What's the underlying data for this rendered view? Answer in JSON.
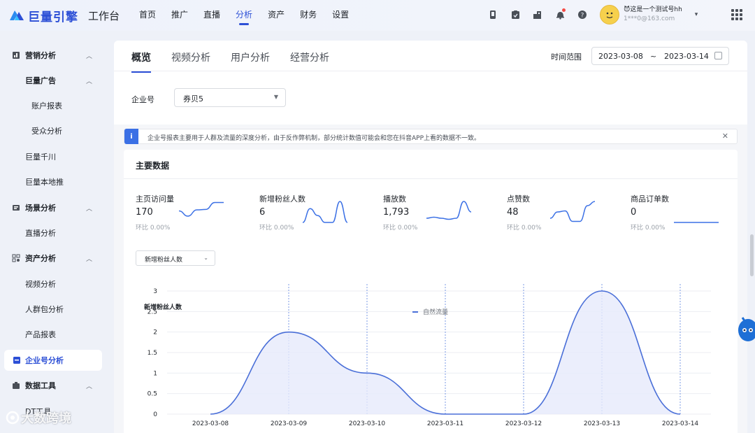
{
  "brand": {
    "logo_text": "巨量引擎",
    "workbench": "工作台"
  },
  "nav": [
    {
      "label": "首页",
      "active": false
    },
    {
      "label": "推广",
      "active": false
    },
    {
      "label": "直播",
      "active": false
    },
    {
      "label": "分析",
      "active": true
    },
    {
      "label": "资产",
      "active": false
    },
    {
      "label": "财务",
      "active": false
    },
    {
      "label": "设置",
      "active": false
    }
  ],
  "top_icons": [
    "phone-icon",
    "clipboard-icon",
    "building-icon",
    "bell-icon",
    "help-icon"
  ],
  "user": {
    "name": "😈这是一个测试号hh",
    "email": "1***0@163.com"
  },
  "sidebar": [
    {
      "label": "营销分析",
      "kind": "group",
      "icon": "chart-icon",
      "caret": true
    },
    {
      "label": "巨量广告",
      "kind": "subgroup",
      "caret": true
    },
    {
      "label": "账户报表",
      "kind": "leaf"
    },
    {
      "label": "受众分析",
      "kind": "leaf"
    },
    {
      "label": "巨量千川",
      "kind": "sub"
    },
    {
      "label": "巨量本地推",
      "kind": "sub"
    },
    {
      "label": "场景分析",
      "kind": "group",
      "icon": "scene-icon",
      "caret": true
    },
    {
      "label": "直播分析",
      "kind": "sub"
    },
    {
      "label": "资产分析",
      "kind": "group",
      "icon": "asset-icon",
      "caret": true
    },
    {
      "label": "视频分析",
      "kind": "sub"
    },
    {
      "label": "人群包分析",
      "kind": "sub"
    },
    {
      "label": "产品报表",
      "kind": "sub"
    },
    {
      "label": "企业号分析",
      "kind": "active",
      "icon": "enterprise-icon"
    },
    {
      "label": "数据工具",
      "kind": "group",
      "icon": "tool-icon",
      "caret": true
    },
    {
      "label": "DT工具",
      "kind": "sub"
    }
  ],
  "tabs": [
    {
      "label": "概览",
      "active": true
    },
    {
      "label": "视频分析",
      "active": false
    },
    {
      "label": "用户分析",
      "active": false
    },
    {
      "label": "经营分析",
      "active": false
    }
  ],
  "date_range": {
    "label": "时间范围",
    "start": "2023-03-08",
    "separator": "~",
    "end": "2023-03-14"
  },
  "company": {
    "label": "企业号",
    "value": "券贝5"
  },
  "notice": {
    "icon": "i",
    "text": "企业号报表主要用于人群及流量的深度分析，由于反作弊机制，部分统计数值可能会和您在抖音APP上看的数据不一致。"
  },
  "panel": {
    "title": "主要数据"
  },
  "metrics": [
    {
      "label": "主页访问量",
      "value": "170",
      "change": "环比 0.00%",
      "spark": [
        0.55,
        0.3,
        0.6,
        0.62,
        0.95,
        0.95
      ]
    },
    {
      "label": "新增粉丝人数",
      "value": "6",
      "change": "环比 0.00%",
      "spark": [
        0,
        0.66,
        0.33,
        0,
        0,
        1,
        0
      ]
    },
    {
      "label": "播放数",
      "value": "1,793",
      "change": "环比 0.00%",
      "spark": [
        0.2,
        0.25,
        0.2,
        0.15,
        0.2,
        1,
        0.5
      ]
    },
    {
      "label": "点赞数",
      "value": "48",
      "change": "环比 0.00%",
      "spark": [
        0.2,
        0.5,
        0.55,
        0.05,
        0.05,
        0.8,
        1
      ]
    },
    {
      "label": "商品订单数",
      "value": "0",
      "change": "环比 0.00%",
      "spark": [
        0,
        0,
        0,
        0,
        0,
        0,
        0
      ]
    }
  ],
  "chart_select": {
    "value": "新增粉丝人数"
  },
  "chart_data": {
    "type": "area",
    "title": "新增粉丝人数",
    "x": [
      "2023-03-08",
      "2023-03-09",
      "2023-03-10",
      "2023-03-11",
      "2023-03-12",
      "2023-03-13",
      "2023-03-14"
    ],
    "series": [
      {
        "name": "自然流量",
        "values": [
          0,
          2,
          1,
          0,
          0,
          3,
          0
        ]
      }
    ],
    "ylim": [
      0,
      3
    ],
    "yticks": [
      0,
      0.5,
      1,
      1.5,
      2,
      2.5,
      3
    ],
    "legend": "top-center",
    "colors": {
      "line": "#4a6fd8",
      "fill": "#e6eafb"
    }
  },
  "watermark": "大数跨境"
}
